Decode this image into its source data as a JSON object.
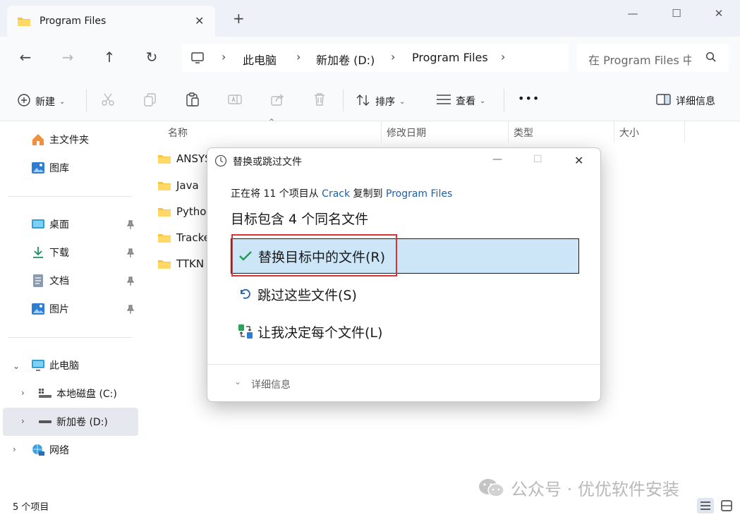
{
  "window": {
    "tab_title": "Program Files",
    "new_tab": "+",
    "minimize": "—",
    "maximize": "☐",
    "close": "✕"
  },
  "nav": {
    "back": "←",
    "forward": "→",
    "up": "↑",
    "refresh": "↻",
    "breadcrumbs": [
      "此电脑",
      "新加卷 (D:)",
      "Program Files"
    ],
    "search_placeholder": "在 Program Files 中"
  },
  "toolbar": {
    "new_label": "新建",
    "sort_label": "排序",
    "view_label": "查看",
    "more_label": "•••",
    "details_label": "详细信息"
  },
  "sidebar": {
    "home": "主文件夹",
    "gallery": "图库",
    "desktop": "桌面",
    "downloads": "下载",
    "documents": "文档",
    "pictures": "图片",
    "this_pc": "此电脑",
    "local_c": "本地磁盘 (C:)",
    "new_d": "新加卷 (D:)",
    "network": "网络"
  },
  "filelist": {
    "columns": [
      "名称",
      "修改日期",
      "类型",
      "大小"
    ],
    "files": [
      "ANSYS",
      "Java",
      "Python",
      "Tracke",
      "TTKN"
    ]
  },
  "status": {
    "count": "5 个项目"
  },
  "dialog": {
    "title": "替换或跳过文件",
    "line_prefix": "正在将 11 个项目从 ",
    "source": "Crack",
    "line_mid": " 复制到 ",
    "dest": "Program Files",
    "heading": "目标包含 4 个同名文件",
    "option_replace": "替换目标中的文件(R)",
    "option_skip": "跳过这些文件(S)",
    "option_decide": "让我决定每个文件(L)",
    "more_details": "详细信息"
  },
  "watermark": {
    "text": "公众号 · 优优软件安装"
  },
  "colors": {
    "accent_blue": "#1f5fa8",
    "highlight": "#cde6f7",
    "annotation_red": "#e03030",
    "folder_yellow": "#f6c342"
  }
}
